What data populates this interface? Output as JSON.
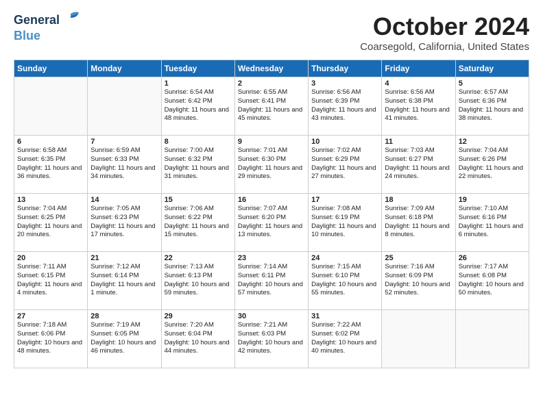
{
  "header": {
    "logo_line1": "General",
    "logo_line2": "Blue",
    "month": "October 2024",
    "location": "Coarsegold, California, United States"
  },
  "weekdays": [
    "Sunday",
    "Monday",
    "Tuesday",
    "Wednesday",
    "Thursday",
    "Friday",
    "Saturday"
  ],
  "weeks": [
    [
      {
        "day": "",
        "info": ""
      },
      {
        "day": "",
        "info": ""
      },
      {
        "day": "1",
        "info": "Sunrise: 6:54 AM\nSunset: 6:42 PM\nDaylight: 11 hours and 48 minutes."
      },
      {
        "day": "2",
        "info": "Sunrise: 6:55 AM\nSunset: 6:41 PM\nDaylight: 11 hours and 45 minutes."
      },
      {
        "day": "3",
        "info": "Sunrise: 6:56 AM\nSunset: 6:39 PM\nDaylight: 11 hours and 43 minutes."
      },
      {
        "day": "4",
        "info": "Sunrise: 6:56 AM\nSunset: 6:38 PM\nDaylight: 11 hours and 41 minutes."
      },
      {
        "day": "5",
        "info": "Sunrise: 6:57 AM\nSunset: 6:36 PM\nDaylight: 11 hours and 38 minutes."
      }
    ],
    [
      {
        "day": "6",
        "info": "Sunrise: 6:58 AM\nSunset: 6:35 PM\nDaylight: 11 hours and 36 minutes."
      },
      {
        "day": "7",
        "info": "Sunrise: 6:59 AM\nSunset: 6:33 PM\nDaylight: 11 hours and 34 minutes."
      },
      {
        "day": "8",
        "info": "Sunrise: 7:00 AM\nSunset: 6:32 PM\nDaylight: 11 hours and 31 minutes."
      },
      {
        "day": "9",
        "info": "Sunrise: 7:01 AM\nSunset: 6:30 PM\nDaylight: 11 hours and 29 minutes."
      },
      {
        "day": "10",
        "info": "Sunrise: 7:02 AM\nSunset: 6:29 PM\nDaylight: 11 hours and 27 minutes."
      },
      {
        "day": "11",
        "info": "Sunrise: 7:03 AM\nSunset: 6:27 PM\nDaylight: 11 hours and 24 minutes."
      },
      {
        "day": "12",
        "info": "Sunrise: 7:04 AM\nSunset: 6:26 PM\nDaylight: 11 hours and 22 minutes."
      }
    ],
    [
      {
        "day": "13",
        "info": "Sunrise: 7:04 AM\nSunset: 6:25 PM\nDaylight: 11 hours and 20 minutes."
      },
      {
        "day": "14",
        "info": "Sunrise: 7:05 AM\nSunset: 6:23 PM\nDaylight: 11 hours and 17 minutes."
      },
      {
        "day": "15",
        "info": "Sunrise: 7:06 AM\nSunset: 6:22 PM\nDaylight: 11 hours and 15 minutes."
      },
      {
        "day": "16",
        "info": "Sunrise: 7:07 AM\nSunset: 6:20 PM\nDaylight: 11 hours and 13 minutes."
      },
      {
        "day": "17",
        "info": "Sunrise: 7:08 AM\nSunset: 6:19 PM\nDaylight: 11 hours and 10 minutes."
      },
      {
        "day": "18",
        "info": "Sunrise: 7:09 AM\nSunset: 6:18 PM\nDaylight: 11 hours and 8 minutes."
      },
      {
        "day": "19",
        "info": "Sunrise: 7:10 AM\nSunset: 6:16 PM\nDaylight: 11 hours and 6 minutes."
      }
    ],
    [
      {
        "day": "20",
        "info": "Sunrise: 7:11 AM\nSunset: 6:15 PM\nDaylight: 11 hours and 4 minutes."
      },
      {
        "day": "21",
        "info": "Sunrise: 7:12 AM\nSunset: 6:14 PM\nDaylight: 11 hours and 1 minute."
      },
      {
        "day": "22",
        "info": "Sunrise: 7:13 AM\nSunset: 6:13 PM\nDaylight: 10 hours and 59 minutes."
      },
      {
        "day": "23",
        "info": "Sunrise: 7:14 AM\nSunset: 6:11 PM\nDaylight: 10 hours and 57 minutes."
      },
      {
        "day": "24",
        "info": "Sunrise: 7:15 AM\nSunset: 6:10 PM\nDaylight: 10 hours and 55 minutes."
      },
      {
        "day": "25",
        "info": "Sunrise: 7:16 AM\nSunset: 6:09 PM\nDaylight: 10 hours and 52 minutes."
      },
      {
        "day": "26",
        "info": "Sunrise: 7:17 AM\nSunset: 6:08 PM\nDaylight: 10 hours and 50 minutes."
      }
    ],
    [
      {
        "day": "27",
        "info": "Sunrise: 7:18 AM\nSunset: 6:06 PM\nDaylight: 10 hours and 48 minutes."
      },
      {
        "day": "28",
        "info": "Sunrise: 7:19 AM\nSunset: 6:05 PM\nDaylight: 10 hours and 46 minutes."
      },
      {
        "day": "29",
        "info": "Sunrise: 7:20 AM\nSunset: 6:04 PM\nDaylight: 10 hours and 44 minutes."
      },
      {
        "day": "30",
        "info": "Sunrise: 7:21 AM\nSunset: 6:03 PM\nDaylight: 10 hours and 42 minutes."
      },
      {
        "day": "31",
        "info": "Sunrise: 7:22 AM\nSunset: 6:02 PM\nDaylight: 10 hours and 40 minutes."
      },
      {
        "day": "",
        "info": ""
      },
      {
        "day": "",
        "info": ""
      }
    ]
  ]
}
